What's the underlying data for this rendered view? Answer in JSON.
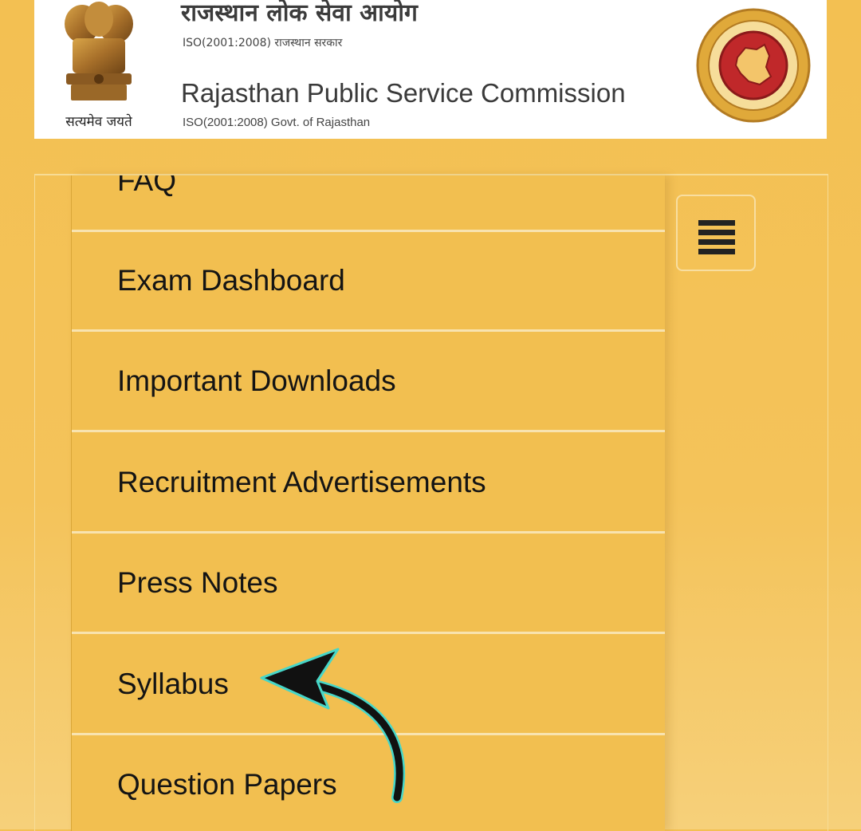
{
  "header": {
    "title_hi": "राजस्थान लोक सेवा आयोग",
    "iso_hi": "ISO(2001:2008) राजस्थान सरकार",
    "title_en": "Rajasthan Public Service Commission",
    "iso_en": "ISO(2001:2008) Govt. of Rajasthan",
    "motto": "सत्यमेव जयते"
  },
  "menu": {
    "items": [
      {
        "label": "FAQ"
      },
      {
        "label": "Exam Dashboard"
      },
      {
        "label": "Important Downloads"
      },
      {
        "label": "Recruitment Advertisements"
      },
      {
        "label": "Press Notes"
      },
      {
        "label": "Syllabus"
      },
      {
        "label": "Question Papers"
      }
    ]
  },
  "icons": {
    "emblem": "national-emblem-icon",
    "seal": "rpsc-seal-icon",
    "toggle": "hamburger-icon",
    "pointer": "curved-arrow-icon"
  },
  "colors": {
    "background": "#f3c052",
    "menu": "#f2bf50",
    "divider": "#f8e3b0",
    "seal_red": "#c0282a",
    "seal_gold": "#e0a93a"
  }
}
